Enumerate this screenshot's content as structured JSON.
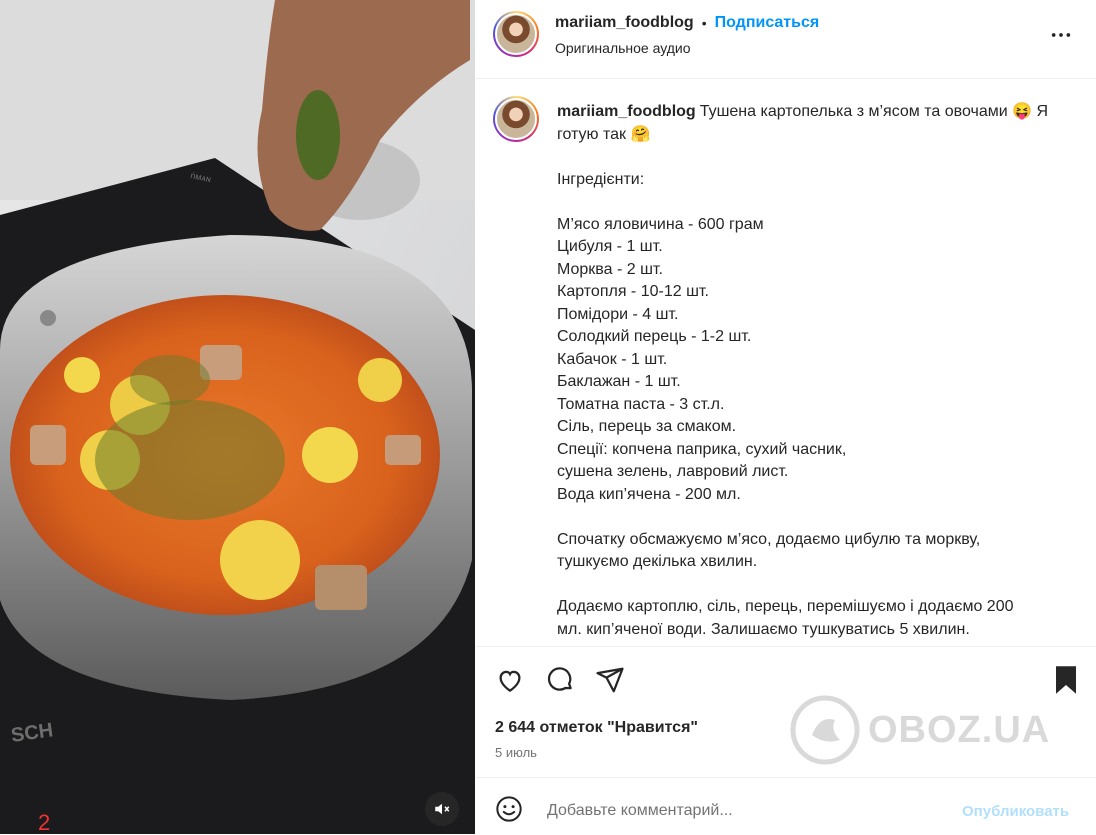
{
  "header": {
    "username": "mariiam_foodblog",
    "separator": "•",
    "follow_label": "Подписаться",
    "audio_label": "Оригинальное аудио",
    "more_label": "•••"
  },
  "caption": {
    "username": "mariiam_foodblog",
    "text": "Тушена картопелька з м’ясом та овочами 😝 Я готую так 🤗\n\nІнгредієнти:\n\nМ’ясо яловичина - 600 грам\nЦибуля - 1 шт.\nМорква - 2 шт.\nКартопля - 10-12 шт.\nПомідори - 4 шт.\nСолодкий перець - 1-2 шт.\nКабачок - 1 шт.\nБаклажан - 1 шт.\nТоматна паста - 3 ст.л.\nСіль, перець за смаком.\nСпеції: копчена паприка, сухий часник,\nсушена зелень, лавровий лист.\nВода кип’ячена - 200 мл.\n\nСпочатку обсмажуємо м’ясо, додаємо цибулю та моркву,\nтушкуємо декілька хвилин.\n\nДодаємо картоплю, сіль, перець, перемішуємо і додаємо 200\nмл. кип’яченої води. Залишаємо тушкуватись 5 хвилин."
  },
  "actions": {
    "likes_text": "2 644 отметок \"Нравится\"",
    "date_text": "5 июль"
  },
  "comment": {
    "placeholder": "Добавьте комментарий...",
    "publish_label": "Опубликовать"
  },
  "media": {
    "corner_mark": "2",
    "stove_text": "SCH",
    "knob_text": "ṅᴍᴀɴ"
  },
  "watermark": {
    "text": "OBOZ.UA"
  },
  "colors": {
    "accent": "#0095f6",
    "publish_disabled": "#b2dffc",
    "text_primary": "#262626",
    "text_secondary": "#737373"
  }
}
